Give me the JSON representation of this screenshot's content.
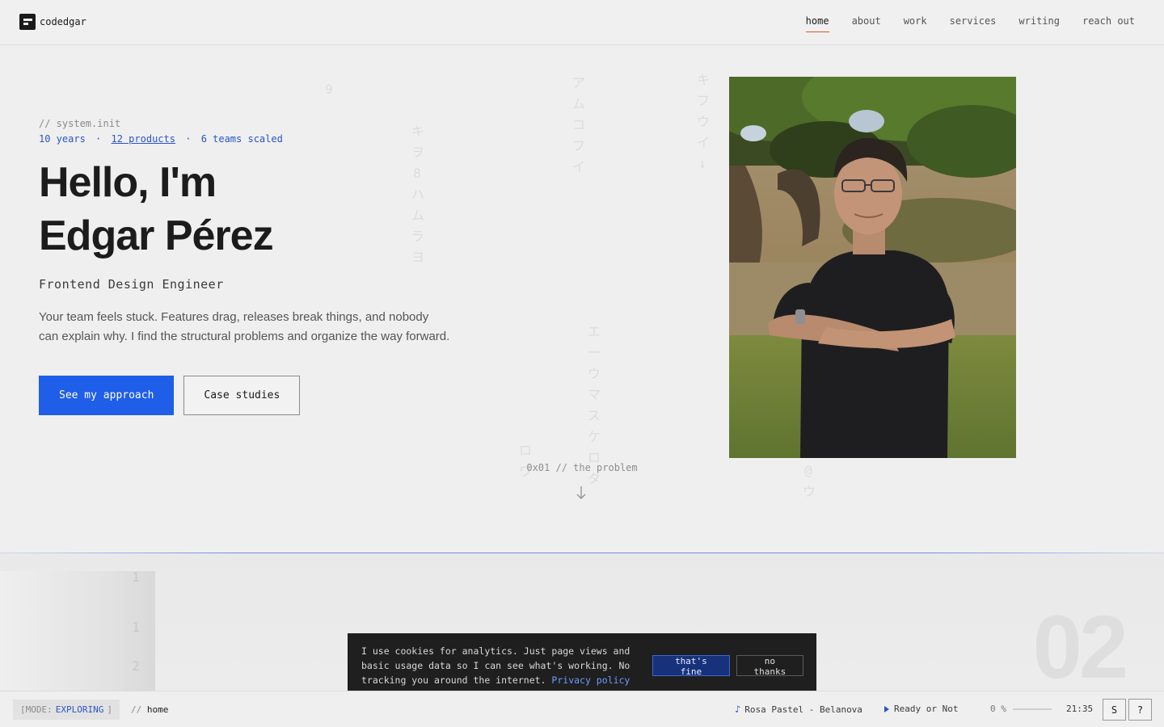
{
  "brand": {
    "name": "codedgar"
  },
  "nav": {
    "items": [
      {
        "label": "home",
        "active": true
      },
      {
        "label": "about",
        "active": false
      },
      {
        "label": "work",
        "active": false
      },
      {
        "label": "services",
        "active": false
      },
      {
        "label": "writing",
        "active": false
      },
      {
        "label": "reach out",
        "active": false
      }
    ]
  },
  "background_glyphs": [
    "9",
    "ア ム コ フ イ",
    "キ ヲ 8 ハ ム ラ ヨ",
    "キ フ ウ イ ↓",
    "エ ー ウ マ ス ケ ロ タ",
    "ロ ワ",
    "@ ウ"
  ],
  "hero": {
    "init_comment": "// system.init",
    "stats": {
      "years": "10 years",
      "separator": "·",
      "products": "12 products",
      "teams": "6 teams scaled"
    },
    "greeting_line1": "Hello, I'm",
    "greeting_line2": "Edgar Pérez",
    "role": "Frontend Design Engineer",
    "pitch": "Your team feels stuck. Features drag, releases break things, and nobody can explain why. I find the structural problems and organize the way forward.",
    "primary_cta": "See my approach",
    "secondary_cta": "Case studies"
  },
  "scroll_hint": {
    "label": "0x01 // the problem",
    "icon": "arrow-down-icon"
  },
  "section2": {
    "side_numbers": [
      "1",
      "1",
      "2"
    ],
    "big_number": "02"
  },
  "cookie": {
    "text": "I use cookies for analytics. Just page views and basic usage data so I can see what's working. No tracking you around the internet.",
    "link": "Privacy policy",
    "accept": "that's fine",
    "decline": "no thanks"
  },
  "status": {
    "mode_prefix": "[MODE:",
    "mode_value": "EXPLORING",
    "mode_suffix": "]",
    "crumb_prefix": "//",
    "crumb_value": "home",
    "track_icon": "♪",
    "track": "Rosa Pastel - Belanova",
    "now_playing": "Ready or Not",
    "volume_label": "0 %",
    "volume_fraction": 0,
    "clock": "21:35",
    "btn_s": "S",
    "btn_help": "?"
  },
  "colors": {
    "accent": "#1f5ee8",
    "link": "#2a55c8",
    "nav_active": "#e0551c"
  }
}
